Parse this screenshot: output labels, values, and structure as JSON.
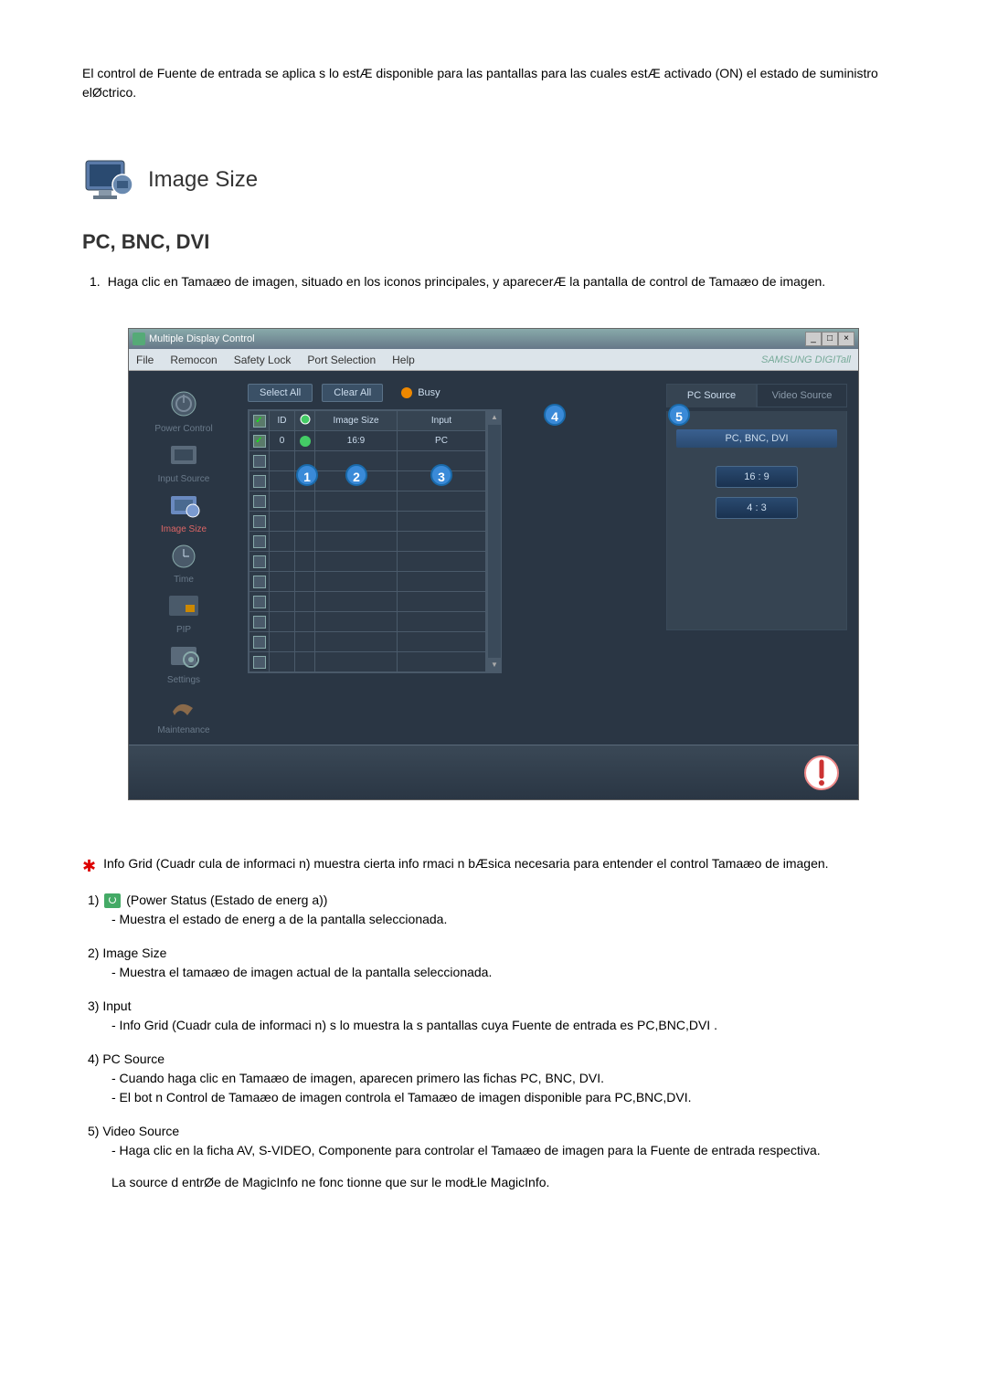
{
  "intro": "El control de Fuente de entrada se aplica s lo estÆ disponible para las pantallas para las cuales estÆ activado (ON) el estado de suministro elØctrico.",
  "section_title": "Image Size",
  "subtitle": "PC, BNC, DVI",
  "numbered": {
    "num": "1.",
    "text": "Haga clic en Tamaæo de imagen, situado en los iconos principales, y aparecerÆ la pantalla de control de Tamaæo de imagen."
  },
  "app": {
    "title": "Multiple Display Control",
    "menu": [
      "File",
      "Remocon",
      "Safety Lock",
      "Port Selection",
      "Help"
    ],
    "brand": "SAMSUNG DIGITall",
    "sidebar": [
      {
        "label": "Power Control",
        "active": false
      },
      {
        "label": "Input Source",
        "active": false
      },
      {
        "label": "Image Size",
        "active": true
      },
      {
        "label": "Time",
        "active": false
      },
      {
        "label": "PIP",
        "active": false
      },
      {
        "label": "Settings",
        "active": false
      },
      {
        "label": "Maintenance",
        "active": false
      }
    ],
    "toolbar": {
      "select_all": "Select All",
      "clear_all": "Clear All",
      "busy": "Busy"
    },
    "grid": {
      "headers": {
        "id": "ID",
        "image_size": "Image Size",
        "input": "Input"
      },
      "row": {
        "id": "0",
        "image_size": "16:9",
        "input": "PC"
      }
    },
    "right": {
      "tab_pc": "PC Source",
      "tab_video": "Video Source",
      "src_label": "PC, BNC, DVI",
      "ratio1": "16 : 9",
      "ratio2": "4 : 3"
    },
    "annot": {
      "a1": "1",
      "a2": "2",
      "a3": "3",
      "a4": "4",
      "a5": "5"
    }
  },
  "star_note": "Info Grid (Cuadr cula de informaci n) muestra cierta info rmaci n bÆsica necesaria para entender el control Tamaæo de imagen.",
  "doc": {
    "i1": {
      "num": "1)",
      "title": "(Power Status (Estado de energ a))",
      "sub": "- Muestra el estado de energ a de la pantalla seleccionada."
    },
    "i2": {
      "num": "2)",
      "title": "Image Size",
      "sub": "- Muestra el tamaæo de imagen actual de la pantalla seleccionada."
    },
    "i3": {
      "num": "3)",
      "title": "Input",
      "sub": "- Info Grid (Cuadr cula de informaci n) s lo muestra la s pantallas cuya Fuente de entrada es PC,BNC,DVI ."
    },
    "i4": {
      "num": "4)",
      "title": "PC Source",
      "sub1": "- Cuando haga clic en Tamaæo de imagen, aparecen primero las fichas PC, BNC, DVI.",
      "sub2": "- El bot n Control de Tamaæo de imagen controla el Tamaæo de imagen disponible para PC,BNC,DVI."
    },
    "i5": {
      "num": "5)",
      "title": "Video Source",
      "sub": "- Haga clic en la ficha AV, S-VIDEO, Componente para controlar el Tamaæo de imagen para la Fuente de entrada respectiva."
    }
  },
  "final": "La source d entrØe de MagicInfo ne fonc tionne que sur le modŁle MagicInfo."
}
